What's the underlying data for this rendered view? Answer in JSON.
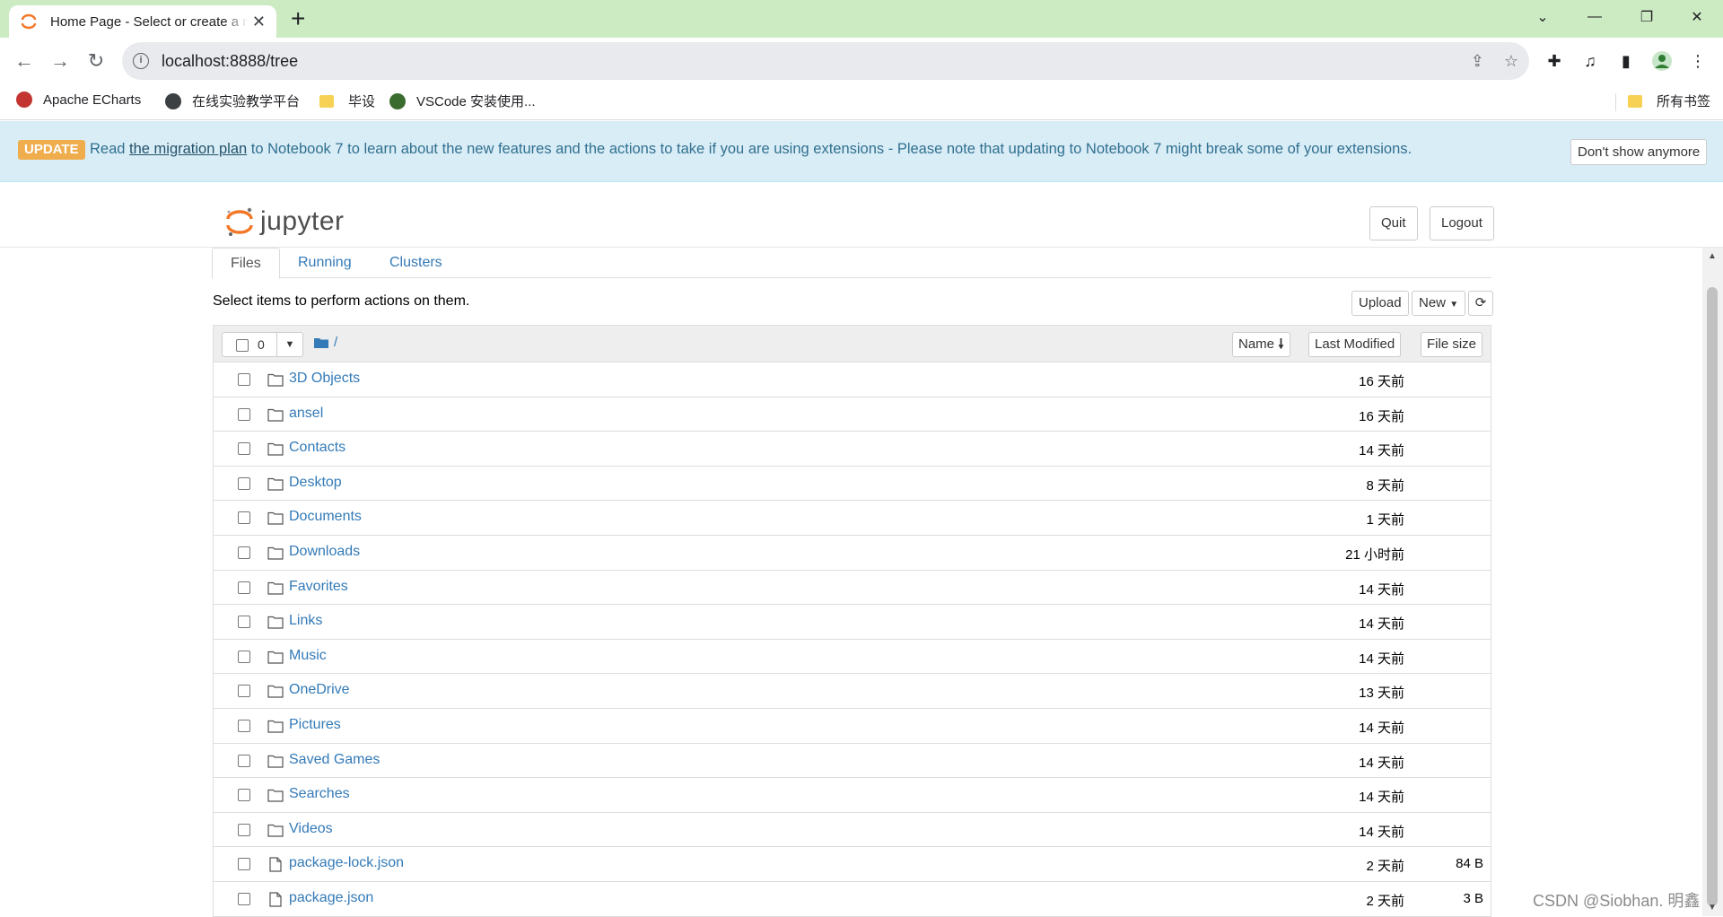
{
  "browser": {
    "tab_title": "Home Page - Select or create a notebook",
    "url": "localhost:8888/tree",
    "bookmarks": [
      {
        "label": "Apache ECharts",
        "icon": "echarts-icon"
      },
      {
        "label": "在线实验教学平台",
        "icon": "globe-icon"
      },
      {
        "label": "毕设",
        "icon": "folder-icon"
      },
      {
        "label": "VSCode 安装使用...",
        "icon": "vscode-favicon"
      }
    ],
    "all_bookmarks": "所有书签"
  },
  "banner": {
    "badge": "UPDATE",
    "text_before": "Read ",
    "link": "the migration plan",
    "text_after": " to Notebook 7 to learn about the new features and the actions to take if you are using extensions - Please note that updating to Notebook 7 might break some of your extensions.",
    "dismiss": "Don't show anymore"
  },
  "header": {
    "logo_text": "jupyter",
    "quit": "Quit",
    "logout": "Logout"
  },
  "tabs": [
    "Files",
    "Running",
    "Clusters"
  ],
  "toolbar": {
    "hint": "Select items to perform actions on them.",
    "upload": "Upload",
    "new": "New"
  },
  "listing": {
    "selected_count": "0",
    "breadcrumb": "/",
    "col_name": "Name",
    "col_modified": "Last Modified",
    "col_size": "File size",
    "rows": [
      {
        "name": "3D Objects",
        "type": "folder",
        "modified": "16 天前",
        "size": ""
      },
      {
        "name": "ansel",
        "type": "folder",
        "modified": "16 天前",
        "size": ""
      },
      {
        "name": "Contacts",
        "type": "folder",
        "modified": "14 天前",
        "size": ""
      },
      {
        "name": "Desktop",
        "type": "folder",
        "modified": "8 天前",
        "size": ""
      },
      {
        "name": "Documents",
        "type": "folder",
        "modified": "1 天前",
        "size": ""
      },
      {
        "name": "Downloads",
        "type": "folder",
        "modified": "21 小时前",
        "size": ""
      },
      {
        "name": "Favorites",
        "type": "folder",
        "modified": "14 天前",
        "size": ""
      },
      {
        "name": "Links",
        "type": "folder",
        "modified": "14 天前",
        "size": ""
      },
      {
        "name": "Music",
        "type": "folder",
        "modified": "14 天前",
        "size": ""
      },
      {
        "name": "OneDrive",
        "type": "folder",
        "modified": "13 天前",
        "size": ""
      },
      {
        "name": "Pictures",
        "type": "folder",
        "modified": "14 天前",
        "size": ""
      },
      {
        "name": "Saved Games",
        "type": "folder",
        "modified": "14 天前",
        "size": ""
      },
      {
        "name": "Searches",
        "type": "folder",
        "modified": "14 天前",
        "size": ""
      },
      {
        "name": "Videos",
        "type": "folder",
        "modified": "14 天前",
        "size": ""
      },
      {
        "name": "package-lock.json",
        "type": "file",
        "modified": "2 天前",
        "size": "84 B"
      },
      {
        "name": "package.json",
        "type": "file",
        "modified": "2 天前",
        "size": "3 B"
      }
    ]
  },
  "watermark": "CSDN @Siobhan. 明鑫",
  "colors": {
    "accent": "#337ab7",
    "badge": "#f0ad4e",
    "banner_bg": "#d9edf7",
    "tabbar": "#cdebc3"
  }
}
